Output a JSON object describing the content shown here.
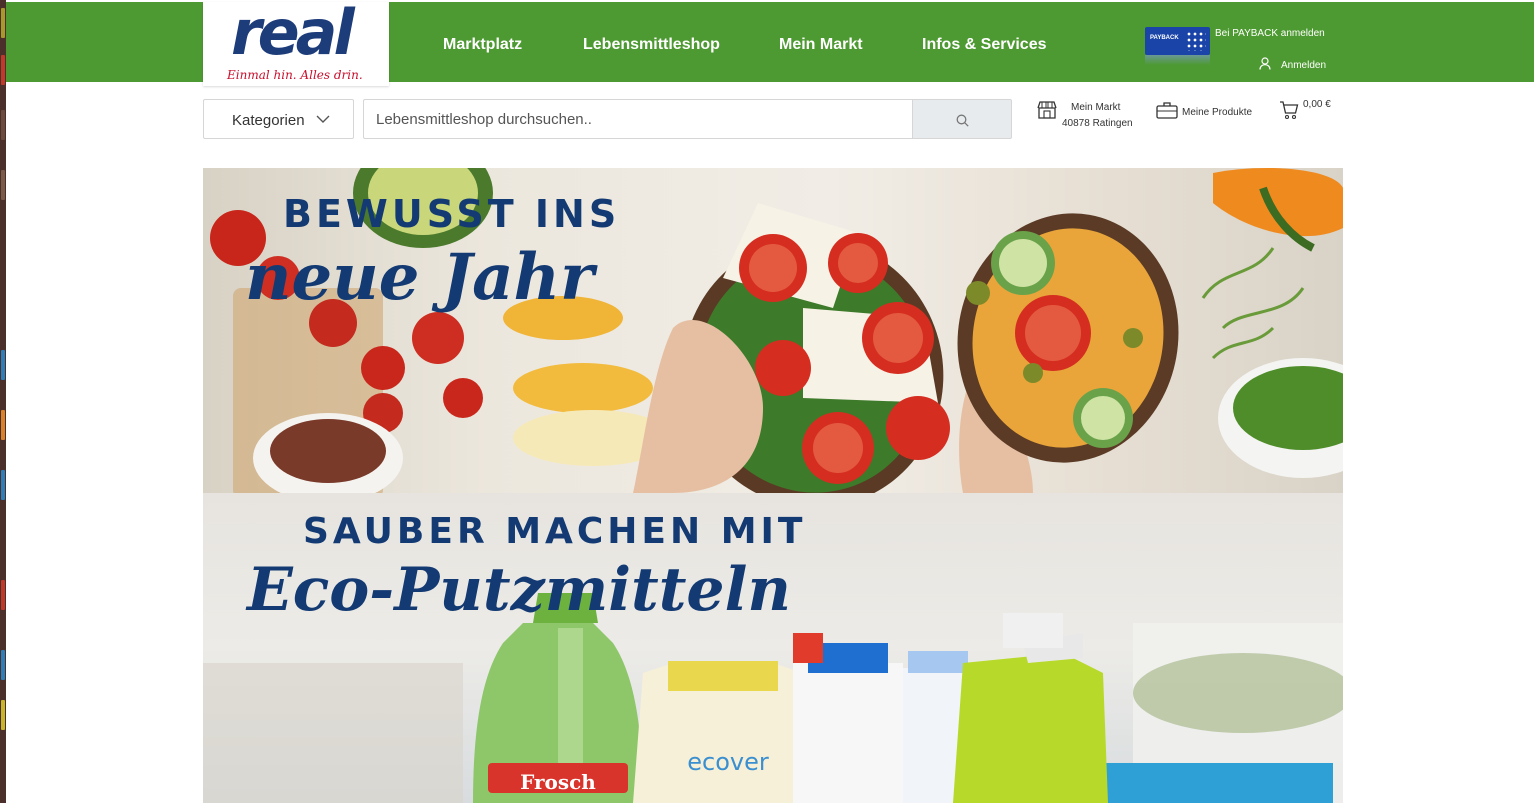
{
  "header": {
    "logo_text": "real",
    "logo_tagline": "Einmal hin. Alles drin.",
    "nav": [
      {
        "label": "Marktplatz"
      },
      {
        "label": "Lebensmittleshop"
      },
      {
        "label": "Mein Markt"
      },
      {
        "label": "Infos & Services"
      }
    ],
    "payback_logo_text": "PAYBACK",
    "payback_link": "Bei PAYBACK anmelden",
    "login_label": "Anmelden"
  },
  "search": {
    "categories_label": "Kategorien",
    "placeholder": "Lebensmittleshop durchsuchen.."
  },
  "utility": {
    "market_title": "Mein Markt",
    "market_location": "40878 Ratingen",
    "products_label": "Meine Produkte",
    "cart_total": "0,00 €"
  },
  "banners": [
    {
      "headline": "BEWUSST INS",
      "script": "neue Jahr"
    },
    {
      "headline": "SAUBER MACHEN MIT",
      "script": "Eco-Putzmitteln",
      "brands": [
        "Frosch",
        "ecover"
      ]
    }
  ],
  "colors": {
    "header_green": "#4e9a32",
    "logo_blue": "#1d3c7a",
    "logo_red": "#c8102e",
    "banner_text_blue": "#133a73",
    "payback_blue": "#1a44a8"
  }
}
